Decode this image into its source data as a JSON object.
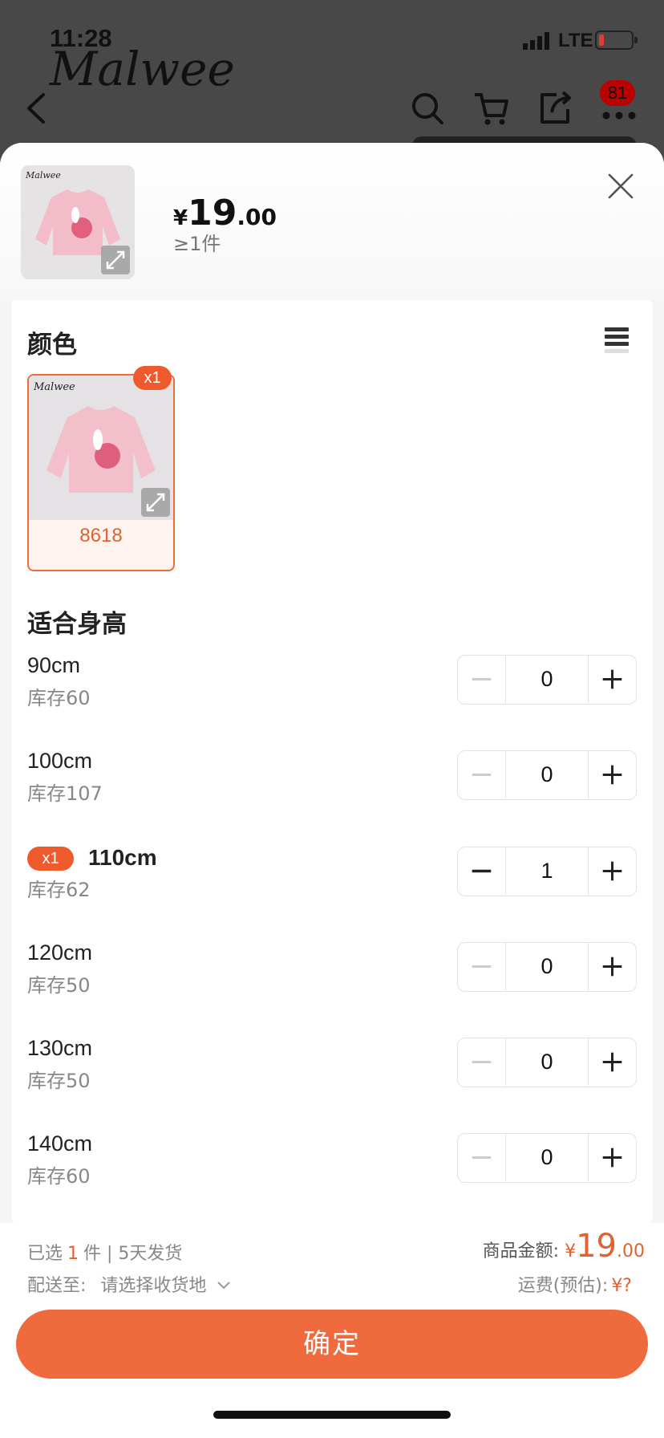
{
  "status_bar": {
    "time": "11:28",
    "network": "LTE"
  },
  "background_page": {
    "brand": "Malwee",
    "cart_count": "81"
  },
  "product": {
    "price_currency": "¥",
    "price_int": "19",
    "price_dec": ".00",
    "moq": "≥1件"
  },
  "color_section": {
    "title": "颜色",
    "swatches": [
      {
        "label": "8618",
        "qty_badge": "x1",
        "brand_mark": "Malwee"
      }
    ]
  },
  "size_section": {
    "title": "适合身高",
    "rows": [
      {
        "size": "90cm",
        "stock": "库存60",
        "qty": "0",
        "selected": false,
        "badge": ""
      },
      {
        "size": "100cm",
        "stock": "库存107",
        "qty": "0",
        "selected": false,
        "badge": ""
      },
      {
        "size": "110cm",
        "stock": "库存62",
        "qty": "1",
        "selected": true,
        "badge": "x1"
      },
      {
        "size": "120cm",
        "stock": "库存50",
        "qty": "0",
        "selected": false,
        "badge": ""
      },
      {
        "size": "130cm",
        "stock": "库存50",
        "qty": "0",
        "selected": false,
        "badge": ""
      },
      {
        "size": "140cm",
        "stock": "库存60",
        "qty": "0",
        "selected": false,
        "badge": ""
      }
    ]
  },
  "footer": {
    "selected_prefix": "已选",
    "selected_count": "1",
    "selected_suffix": "件 | 5天发货",
    "ship_to_label": "配送至:",
    "ship_to_value": "请选择收货地",
    "amount_label": "商品金额:",
    "amount_currency": "¥",
    "amount_int": "19",
    "amount_dec": ".00",
    "freight_label": "运费(预估):",
    "freight_value": "¥?",
    "confirm_label": "确定"
  },
  "colors": {
    "accent": "#ef6a3c",
    "badge": "#ef5a2d"
  }
}
